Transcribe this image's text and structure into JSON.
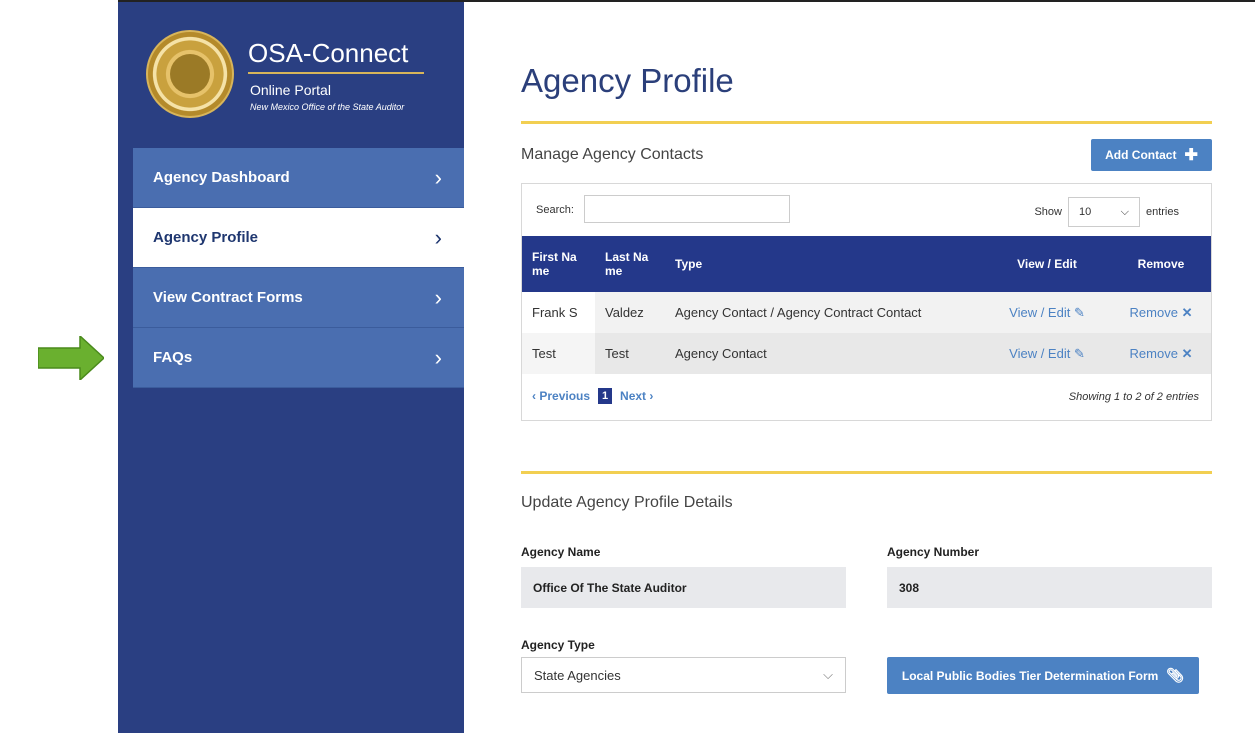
{
  "brand": {
    "title": "OSA-Connect",
    "subtitle": "Online Portal",
    "tagline": "New Mexico Office of the State Auditor"
  },
  "sidebar": {
    "items": [
      {
        "label": "Agency Dashboard",
        "icon": "chevron-right-icon",
        "active": false
      },
      {
        "label": "Agency Profile",
        "icon": "chevron-right-icon",
        "active": true
      },
      {
        "label": "View Contract Forms",
        "icon": "chevron-right-icon",
        "active": false
      },
      {
        "label": "FAQs",
        "icon": "chevron-right-icon",
        "active": false
      }
    ]
  },
  "main": {
    "page_title": "Agency Profile",
    "contacts": {
      "section_title": "Manage Agency Contacts",
      "add_button": "Add Contact",
      "search_label": "Search:",
      "search_value": "",
      "show_label": "Show",
      "show_value": "10",
      "entries_label": "entries",
      "columns": [
        "First Na me",
        "Last Na me",
        "Type",
        "View / Edit",
        "Remove"
      ],
      "rows": [
        {
          "first": "Frank S",
          "last": "Valdez",
          "type": "Agency Contact / Agency Contract Contact",
          "view": "View / Edit",
          "remove": "Remove"
        },
        {
          "first": "Test",
          "last": "Test",
          "type": "Agency Contact",
          "view": "View / Edit",
          "remove": "Remove"
        }
      ],
      "previous": "Previous",
      "page": "1",
      "next": "Next",
      "showing": "Showing 1 to 2 of 2 entries"
    },
    "details": {
      "section_title": "Update Agency Profile Details",
      "agency_name_label": "Agency Name",
      "agency_name_value": "Office Of The State Auditor",
      "agency_number_label": "Agency Number",
      "agency_number_value": "308",
      "agency_type_label": "Agency Type",
      "agency_type_value": "State Agencies",
      "tier_button": "Local Public Bodies Tier Determination Form"
    }
  },
  "colors": {
    "sidebar": "#2a3f82",
    "nav_item": "#4a6eb0",
    "table_header": "#24388a",
    "accent": "#4c82c3",
    "gold": "#f2cf51",
    "arrow": "#6ab02f"
  }
}
